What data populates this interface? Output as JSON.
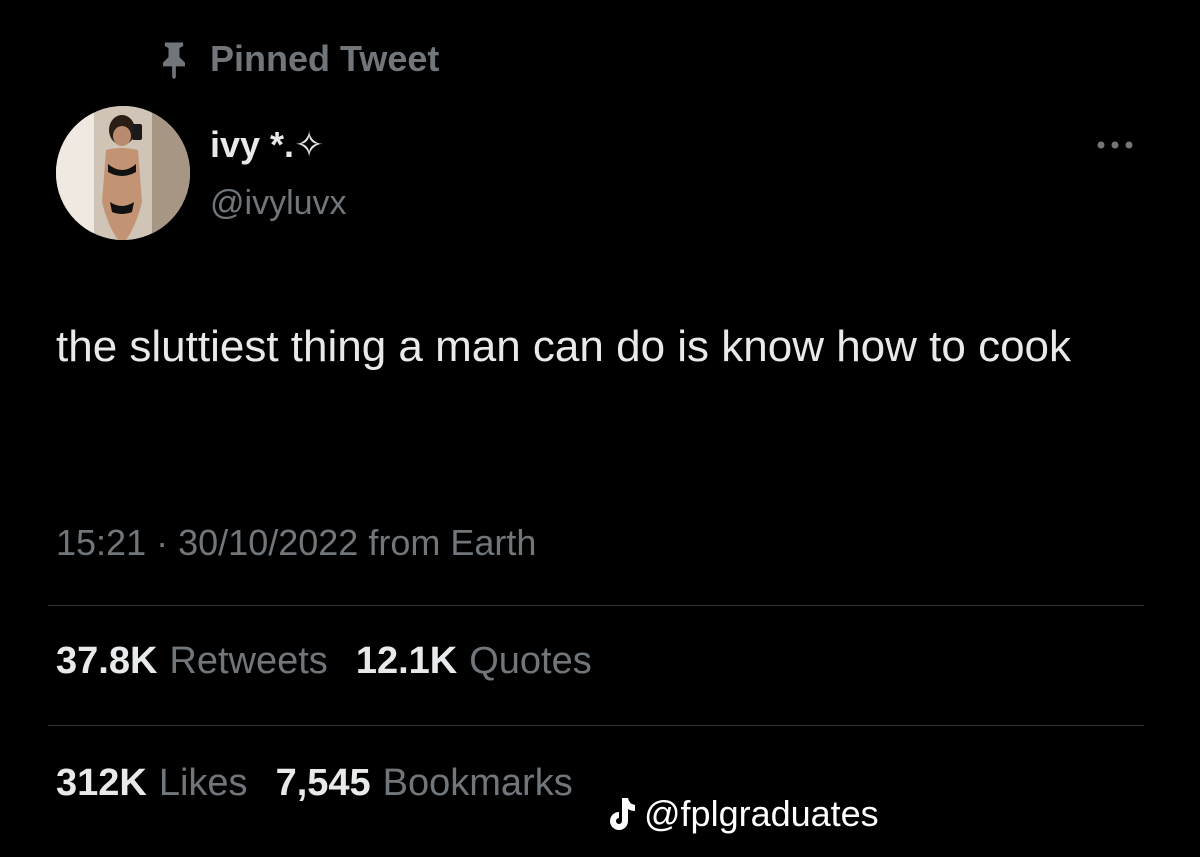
{
  "tweet": {
    "pinned_label": "Pinned Tweet",
    "author": {
      "display_name": "ivy *.✧",
      "handle": "@ivyluvx",
      "avatar": "profile-photo"
    },
    "text": "the sluttiest thing a man can do is know how to cook",
    "time": "15:21",
    "separator": "·",
    "date": "30/10/2022",
    "source": "from Earth",
    "stats_row_1": [
      {
        "value": "37.8K",
        "label": "Retweets"
      },
      {
        "value": "12.1K",
        "label": "Quotes"
      }
    ],
    "stats_row_2": [
      {
        "value": "312K",
        "label": "Likes"
      },
      {
        "value": "7,545",
        "label": "Bookmarks"
      }
    ]
  },
  "icons": {
    "pin": "pin-icon",
    "more": "more-options-icon",
    "tiktok": "tiktok-logo-icon"
  },
  "watermark": {
    "text": "@fplgraduates"
  },
  "colors": {
    "background": "#000000",
    "primary_text": "#e7e9ea",
    "secondary_text": "#71767b",
    "divider": "#2f3336"
  }
}
